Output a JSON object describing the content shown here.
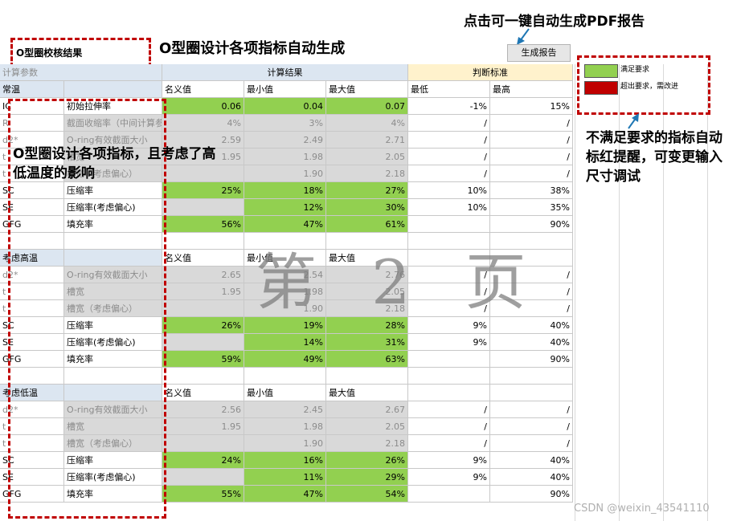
{
  "top_callout": "点击可一键自动生成PDF报告",
  "heading_callout": "O型圈设计各项指标自动生成",
  "report_title": "O型圈校核结果",
  "generate_button": "生成报告",
  "left_callout": "O型圈设计各项指标，且考虑了高低温度的影响",
  "right_callout": "不满足要求的指标自动标红提醒，可变更输入尺寸调试",
  "legend": {
    "ok_label": "满足要求",
    "fail_label": "超出要求，需改进",
    "ok_color": "#92d050",
    "fail_color": "#c00000"
  },
  "watermark": "第 2 页",
  "csdn": "CSDN @weixin_43541110",
  "headers": {
    "params": "计算参数",
    "results": "计算结果",
    "criteria": "判断标准",
    "nominal": "名义值",
    "min": "最小值",
    "max": "最大值",
    "low": "最低",
    "high": "最高"
  },
  "sections": [
    {
      "title": "常温",
      "rows": [
        {
          "code": "IC",
          "name": "初始拉伸率",
          "nom": "0.06",
          "min": "0.04",
          "max": "0.07",
          "low": "-1%",
          "high": "15%"
        },
        {
          "code": "R",
          "name": "截面收缩率（中间计算参数，可不看）",
          "nom": "4%",
          "min": "3%",
          "max": "4%",
          "low": "/",
          "high": "/"
        },
        {
          "code": "d2*",
          "name": "O-ring有效截面大小",
          "nom": "2.59",
          "min": "2.49",
          "max": "2.71",
          "low": "/",
          "high": "/"
        },
        {
          "code": "t",
          "name": "槽宽",
          "nom": "1.95",
          "min": "1.98",
          "max": "2.05",
          "low": "/",
          "high": "/"
        },
        {
          "code": "t",
          "name": "槽宽（考虑偏心）",
          "nom": "",
          "min": "1.90",
          "max": "2.18",
          "low": "/",
          "high": "/"
        },
        {
          "code": "SC",
          "name": "压缩率",
          "nom": "25%",
          "min": "18%",
          "max": "27%",
          "low": "10%",
          "high": "38%"
        },
        {
          "code": "SE",
          "name": "压缩率(考虑偏心)",
          "nom": "",
          "min": "12%",
          "max": "30%",
          "low": "10%",
          "high": "35%"
        },
        {
          "code": "GFG",
          "name": "填充率",
          "nom": "56%",
          "min": "47%",
          "max": "61%",
          "low": "",
          "high": "90%"
        }
      ]
    },
    {
      "title": "考虑高温",
      "rows": [
        {
          "code": "d2*",
          "name": "O-ring有效截面大小",
          "nom": "2.65",
          "min": "2.54",
          "max": "2.76",
          "low": "/",
          "high": "/"
        },
        {
          "code": "t",
          "name": "槽宽",
          "nom": "1.95",
          "min": "1.98",
          "max": "2.05",
          "low": "/",
          "high": "/"
        },
        {
          "code": "t",
          "name": "槽宽（考虑偏心）",
          "nom": "",
          "min": "1.90",
          "max": "2.18",
          "low": "/",
          "high": "/"
        },
        {
          "code": "SC",
          "name": "压缩率",
          "nom": "26%",
          "min": "19%",
          "max": "28%",
          "low": "9%",
          "high": "40%"
        },
        {
          "code": "SE",
          "name": "压缩率(考虑偏心)",
          "nom": "",
          "min": "14%",
          "max": "31%",
          "low": "9%",
          "high": "40%"
        },
        {
          "code": "GFG",
          "name": "填充率",
          "nom": "59%",
          "min": "49%",
          "max": "63%",
          "low": "",
          "high": "90%"
        }
      ]
    },
    {
      "title": "考虑低温",
      "rows": [
        {
          "code": "d2*",
          "name": "O-ring有效截面大小",
          "nom": "2.56",
          "min": "2.45",
          "max": "2.67",
          "low": "/",
          "high": "/"
        },
        {
          "code": "t",
          "name": "槽宽",
          "nom": "1.95",
          "min": "1.98",
          "max": "2.05",
          "low": "/",
          "high": "/"
        },
        {
          "code": "t",
          "name": "槽宽（考虑偏心）",
          "nom": "",
          "min": "1.90",
          "max": "2.18",
          "low": "/",
          "high": "/"
        },
        {
          "code": "SC",
          "name": "压缩率",
          "nom": "24%",
          "min": "16%",
          "max": "26%",
          "low": "9%",
          "high": "40%"
        },
        {
          "code": "SE",
          "name": "压缩率(考虑偏心)",
          "nom": "",
          "min": "11%",
          "max": "29%",
          "low": "9%",
          "high": "40%"
        },
        {
          "code": "GFG",
          "name": "填充率",
          "nom": "55%",
          "min": "47%",
          "max": "54%",
          "low": "",
          "high": "90%"
        }
      ]
    }
  ]
}
